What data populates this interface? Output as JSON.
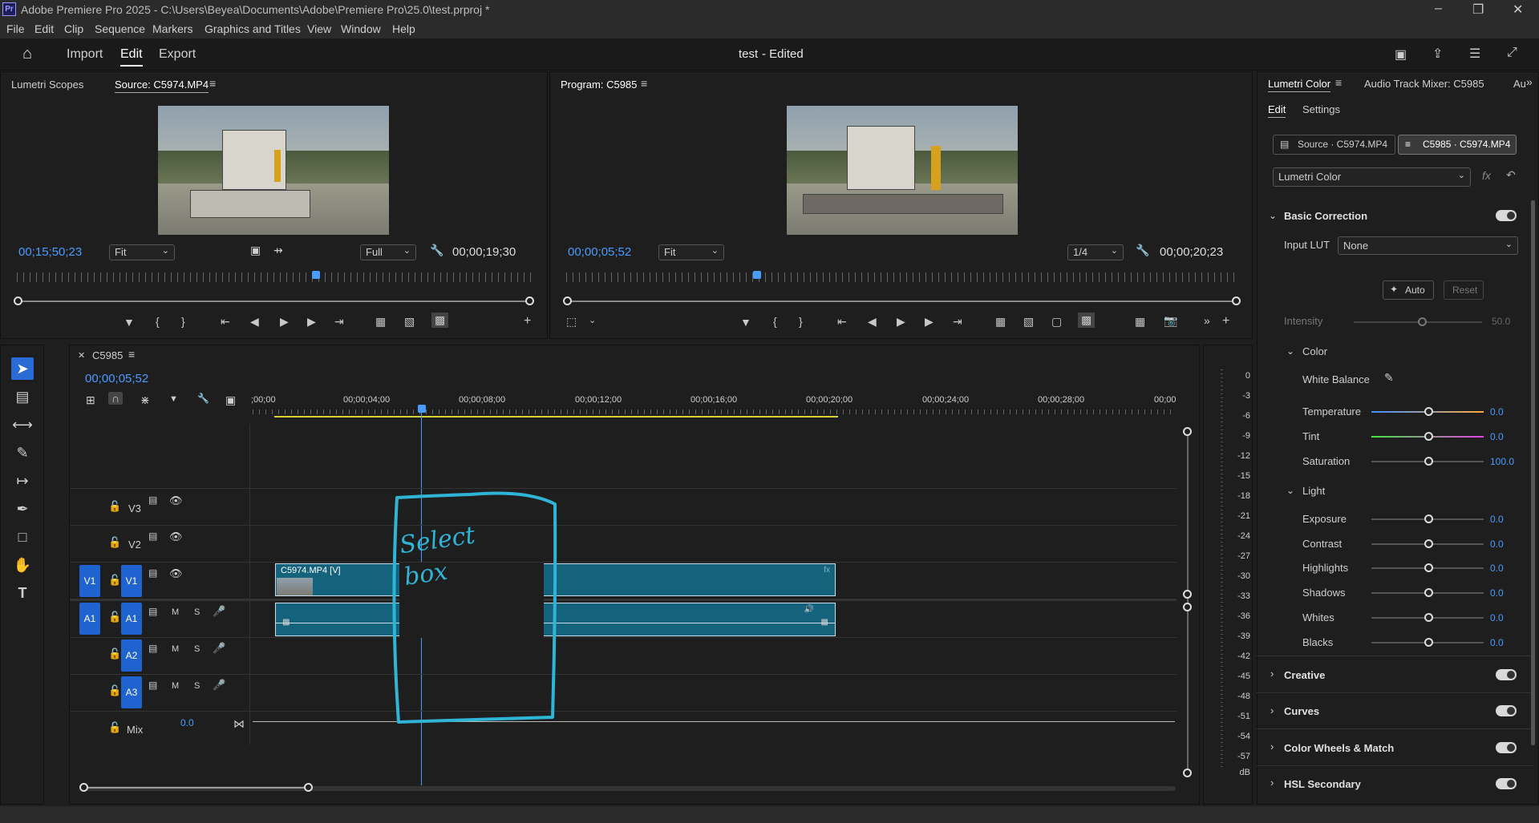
{
  "app": {
    "title": "Adobe Premiere Pro 2025 - C:\\Users\\Beyea\\Documents\\Adobe\\Premiere Pro\\25.0\\test.prproj *",
    "logo": "Pr"
  },
  "menu": [
    "File",
    "Edit",
    "Clip",
    "Sequence",
    "Markers",
    "Graphics and Titles",
    "View",
    "Window",
    "Help"
  ],
  "header": {
    "import": "Import",
    "edit": "Edit",
    "export": "Export",
    "project_title": "test",
    "project_status": "- Edited"
  },
  "source": {
    "tab_scopes": "Lumetri Scopes",
    "tab_source": "Source: C5974.MP4",
    "timecode": "00;15;50;23",
    "fit": "Fit",
    "quality": "Full",
    "duration": "00;00;19;30"
  },
  "program": {
    "tab": "Program: C5985",
    "timecode": "00;00;05;52",
    "fit": "Fit",
    "quality": "1/4",
    "duration": "00;00;20;23"
  },
  "timeline": {
    "tab": "C5985",
    "timecode": "00;00;05;52",
    "ticks": [
      ";00;00",
      "00;00;04;00",
      "00;00;08;00",
      "00;00;12;00",
      "00;00;16;00",
      "00;00;20;00",
      "00;00;24;00",
      "00;00;28;00",
      "00;00"
    ],
    "tracks": {
      "v3": "V3",
      "v2": "V2",
      "v1": "V1",
      "a1": "A1",
      "a2": "A2",
      "a3": "A3",
      "mix": "Mix",
      "mix_val": "0.0",
      "src_v1": "V1",
      "src_a1": "A1"
    },
    "clip_label": "C5974.MP4 [V]",
    "m": "M",
    "s": "S",
    "annotation": "Select box"
  },
  "meter": [
    "0",
    "-3",
    "-6",
    "-9",
    "-12",
    "-15",
    "-18",
    "-21",
    "-24",
    "-27",
    "-30",
    "-33",
    "-36",
    "-39",
    "-42",
    "-45",
    "-48",
    "-51",
    "-54",
    "-57",
    "dB"
  ],
  "lumetri": {
    "tab": "Lumetri Color",
    "tab2": "Audio Track Mixer: C5985",
    "tab3": "Au",
    "edit": "Edit",
    "settings": "Settings",
    "source_btn": "Source · C5974.MP4",
    "seq_btn": "C5985 · C5974.MP4",
    "effect": "Lumetri Color",
    "basic": "Basic Correction",
    "input_lut": "Input LUT",
    "lut_val": "None",
    "auto": "Auto",
    "reset": "Reset",
    "intensity": "Intensity",
    "intensity_val": "50.0",
    "color": "Color",
    "white_balance": "White Balance",
    "temperature": "Temperature",
    "temperature_val": "0.0",
    "tint": "Tint",
    "tint_val": "0.0",
    "saturation": "Saturation",
    "saturation_val": "100.0",
    "light": "Light",
    "exposure": "Exposure",
    "exposure_val": "0.0",
    "contrast": "Contrast",
    "contrast_val": "0.0",
    "highlights": "Highlights",
    "highlights_val": "0.0",
    "shadows": "Shadows",
    "shadows_val": "0.0",
    "whites": "Whites",
    "whites_val": "0.0",
    "blacks": "Blacks",
    "blacks_val": "0.0",
    "creative": "Creative",
    "curves": "Curves",
    "wheels": "Color Wheels & Match",
    "hsl": "HSL Secondary"
  },
  "colors": {
    "accent": "#2a6bd6",
    "timecode": "#4a9bff",
    "clip": "#15627d",
    "annotation": "#2fb4d6"
  }
}
